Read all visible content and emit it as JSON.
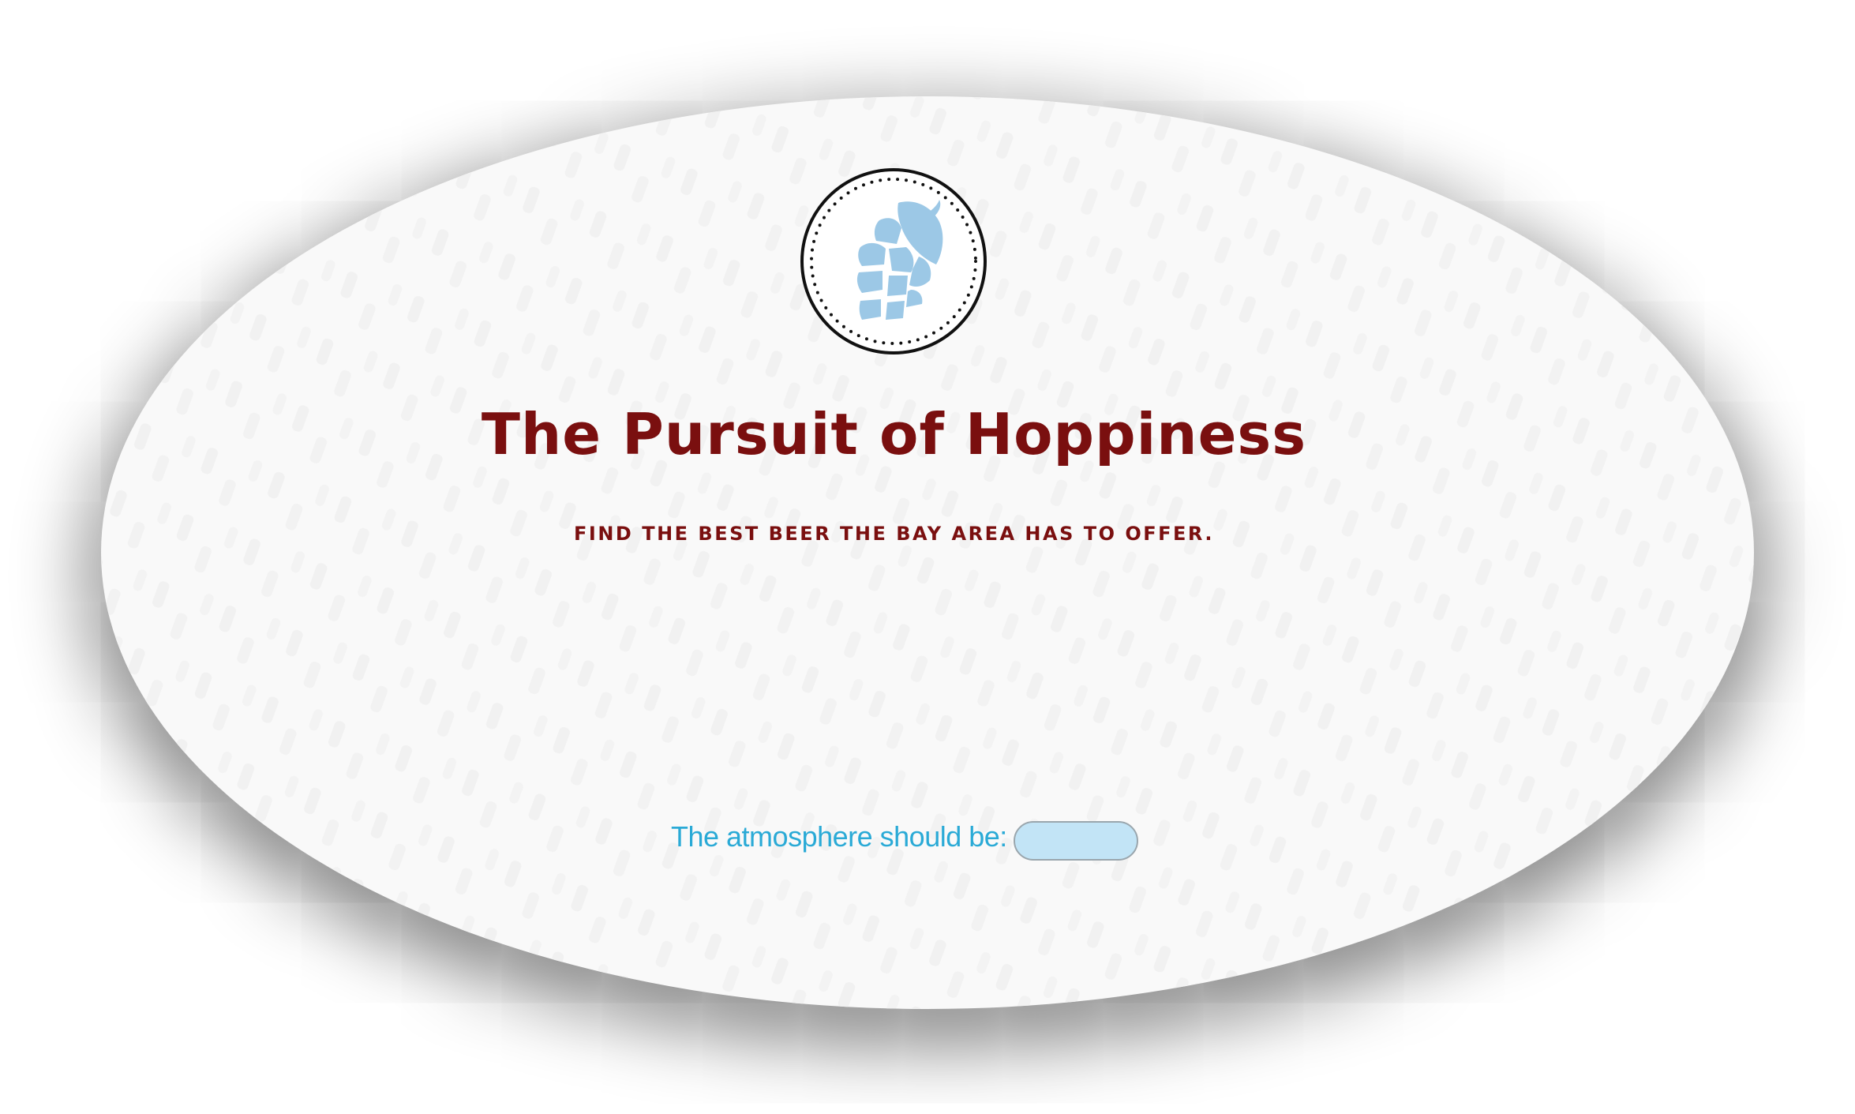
{
  "header": {
    "logo_icon": "hop-cone-icon",
    "title": "The Pursuit of Hoppiness",
    "subtitle": "FIND THE BEST BEER THE BAY AREA HAS TO OFFER."
  },
  "form": {
    "atmosphere_label": "The atmosphere should be:",
    "atmosphere_value": ""
  },
  "colors": {
    "brand": "#7a0f0f",
    "accent": "#2aaad6",
    "hop": "#9cc8e6",
    "select_bg": "#c2e4f6"
  }
}
